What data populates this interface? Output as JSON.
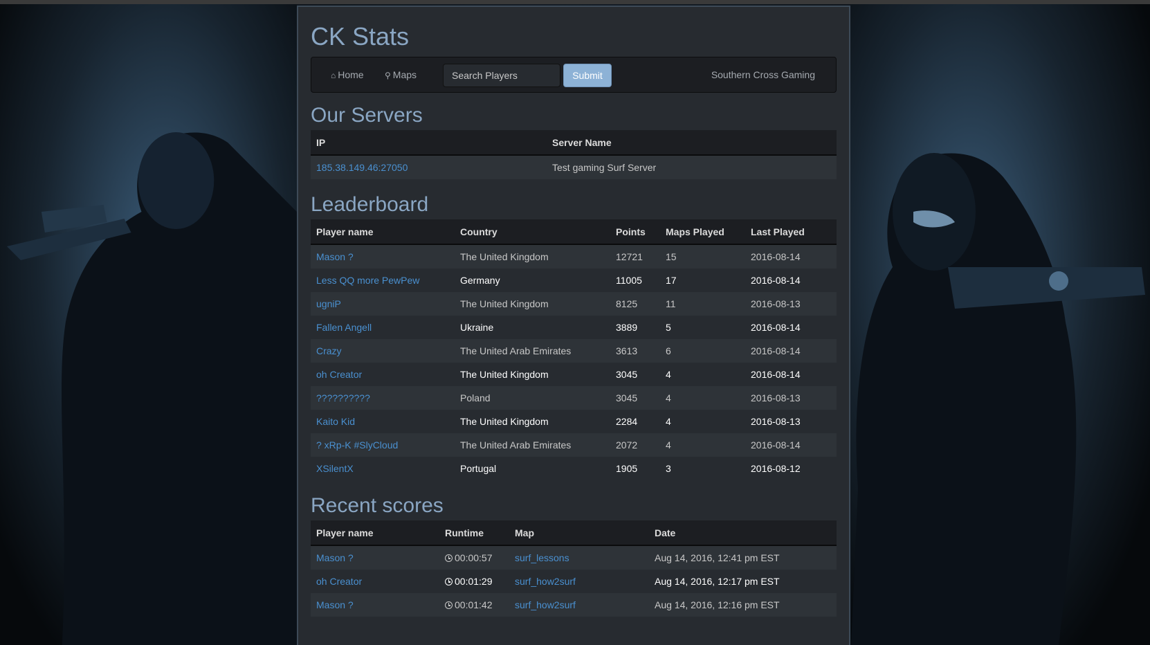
{
  "app": {
    "title": "CK Stats"
  },
  "nav": {
    "home_label": "Home",
    "maps_label": "Maps",
    "search_placeholder": "Search Players",
    "submit_label": "Submit",
    "brand": "Southern Cross Gaming",
    "icons": {
      "home": "home-icon",
      "maps": "map-marker-icon"
    }
  },
  "servers": {
    "heading": "Our Servers",
    "columns": [
      "IP",
      "Server Name"
    ],
    "rows": [
      {
        "ip": "185.38.149.46:27050",
        "name": "Test gaming Surf Server"
      }
    ]
  },
  "leaderboard": {
    "heading": "Leaderboard",
    "columns": [
      "Player name",
      "Country",
      "Points",
      "Maps Played",
      "Last Played"
    ],
    "rows": [
      {
        "player": "Mason ?",
        "country": "The United Kingdom",
        "points": "12721",
        "maps": "15",
        "last": "2016-08-14"
      },
      {
        "player": "Less QQ more PewPew",
        "country": "Germany",
        "points": "11005",
        "maps": "17",
        "last": "2016-08-14"
      },
      {
        "player": "ugniP",
        "country": "The United Kingdom",
        "points": "8125",
        "maps": "11",
        "last": "2016-08-13"
      },
      {
        "player": "Fallen Angell",
        "country": "Ukraine",
        "points": "3889",
        "maps": "5",
        "last": "2016-08-14"
      },
      {
        "player": "Crazy",
        "country": "The United Arab Emirates",
        "points": "3613",
        "maps": "6",
        "last": "2016-08-14"
      },
      {
        "player": "oh Creator",
        "country": "The United Kingdom",
        "points": "3045",
        "maps": "4",
        "last": "2016-08-14"
      },
      {
        "player": "??????????",
        "country": "Poland",
        "points": "3045",
        "maps": "4",
        "last": "2016-08-13"
      },
      {
        "player": "Kaito Kid",
        "country": "The United Kingdom",
        "points": "2284",
        "maps": "4",
        "last": "2016-08-13"
      },
      {
        "player": "? xRp-K #SlyCloud",
        "country": "The United Arab Emirates",
        "points": "2072",
        "maps": "4",
        "last": "2016-08-14"
      },
      {
        "player": "XSilentX",
        "country": "Portugal",
        "points": "1905",
        "maps": "3",
        "last": "2016-08-12"
      }
    ]
  },
  "recent": {
    "heading": "Recent scores",
    "columns": [
      "Player name",
      "Runtime",
      "Map",
      "Date"
    ],
    "rows": [
      {
        "player": "Mason ?",
        "runtime": "00:00:57",
        "map": "surf_lessons",
        "date": "Aug 14, 2016, 12:41 pm EST"
      },
      {
        "player": "oh Creator",
        "runtime": "00:01:29",
        "map": "surf_how2surf",
        "date": "Aug 14, 2016, 12:17 pm EST"
      },
      {
        "player": "Mason ?",
        "runtime": "00:01:42",
        "map": "surf_how2surf",
        "date": "Aug 14, 2016, 12:16 pm EST"
      }
    ]
  },
  "colors": {
    "accent": "#8aa6c3",
    "link": "#4a90d0",
    "button": "#8db2d6",
    "panel": "#272b30"
  }
}
